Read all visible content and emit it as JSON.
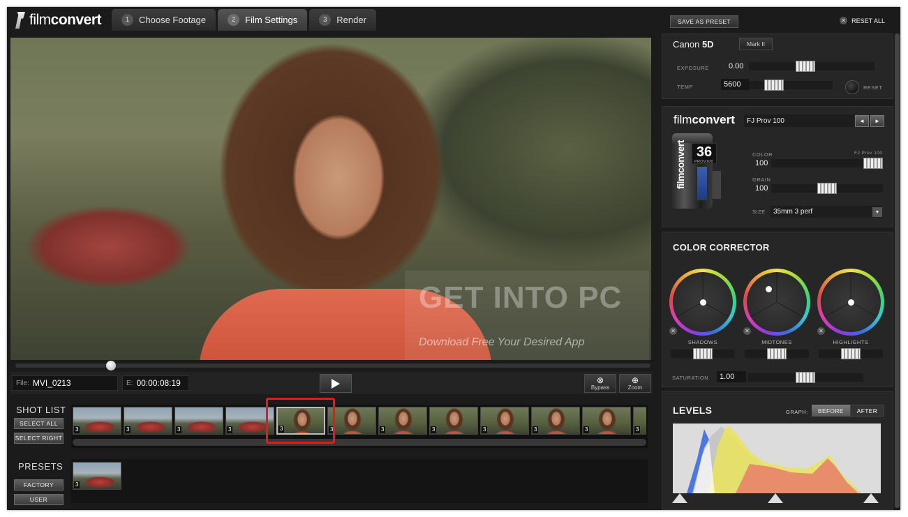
{
  "header": {
    "logo_light": "film",
    "logo_bold": "convert",
    "tabs": [
      {
        "num": "1",
        "label": "Choose Footage"
      },
      {
        "num": "2",
        "label": "Film Settings"
      },
      {
        "num": "3",
        "label": "Render"
      }
    ]
  },
  "viewer": {
    "watermark_title": "GET INTO PC",
    "watermark_subtitle": "Download Free Your Desired App",
    "scrubber_position": 0.15
  },
  "infobar": {
    "file_label": "File:",
    "file_name": "MVI_0213",
    "time_label": "E:",
    "timecode": "00:00:08:19",
    "bypass_label": "Bypass",
    "zoom_label": "Zoom"
  },
  "shot_list": {
    "title": "SHOT LIST",
    "select_all": "SELECT ALL",
    "select_right": "SELECT RIGHT",
    "thumbs": [
      {
        "kind": "car",
        "count": "3"
      },
      {
        "kind": "car",
        "count": "3"
      },
      {
        "kind": "car",
        "count": "3"
      },
      {
        "kind": "car",
        "count": "3"
      },
      {
        "kind": "girl",
        "count": "3",
        "selected": true
      },
      {
        "kind": "girl",
        "count": "3"
      },
      {
        "kind": "girl",
        "count": "3"
      },
      {
        "kind": "girl",
        "count": "3"
      },
      {
        "kind": "girl",
        "count": "3"
      },
      {
        "kind": "girl",
        "count": "3"
      },
      {
        "kind": "girl",
        "count": "3"
      },
      {
        "kind": "girl",
        "count": "3"
      }
    ]
  },
  "presets": {
    "title": "PRESETS",
    "factory": "FACTORY",
    "user": "USER",
    "thumb_count": "3"
  },
  "right_panel": {
    "save_preset": "SAVE AS PRESET",
    "reset_all": "RESET ALL",
    "camera": {
      "make": "Canon",
      "model": "5D",
      "variant": "Mark II",
      "exposure_label": "EXPOSURE",
      "exposure": "0.00",
      "exposure_pos": 0.45,
      "temp_label": "TEMP",
      "temp": "5600",
      "temp_pos": 0.3,
      "reset_label": "RESET"
    },
    "film": {
      "logo_light": "film",
      "logo_bold": "convert",
      "stock": "FJ Prov 100",
      "prev_icon": "◄",
      "next_icon": "►",
      "can_number": "36",
      "can_sub": "PROV100",
      "can_brand": "filmconvert",
      "color_label": "COLOR",
      "color_stock": "FJ Prov 100",
      "color": "100",
      "color_pos": 1.0,
      "grain_label": "GRAIN",
      "grain": "100",
      "grain_pos": 0.5,
      "size_label": "SIZE",
      "size": "35mm 3 perf"
    },
    "color_corrector": {
      "title": "COLOR CORRECTOR",
      "wheels": [
        {
          "name": "SHADOWS",
          "dot_x": 0.5,
          "dot_y": 0.5,
          "slider_pos": 0.5
        },
        {
          "name": "MIDTONES",
          "dot_x": 0.37,
          "dot_y": 0.28,
          "slider_pos": 0.5
        },
        {
          "name": "HIGHLIGHTS",
          "dot_x": 0.5,
          "dot_y": 0.5,
          "slider_pos": 0.5
        }
      ],
      "saturation_label": "SATURATION",
      "saturation": "1.00",
      "saturation_pos": 0.5
    },
    "levels": {
      "title": "LEVELS",
      "graph_label": "GRAPH:",
      "before": "BEFORE",
      "after": "AFTER"
    }
  },
  "colors": {
    "highlight": "#e31a1a",
    "panel": "#262626",
    "background": "#1b1b1b"
  }
}
